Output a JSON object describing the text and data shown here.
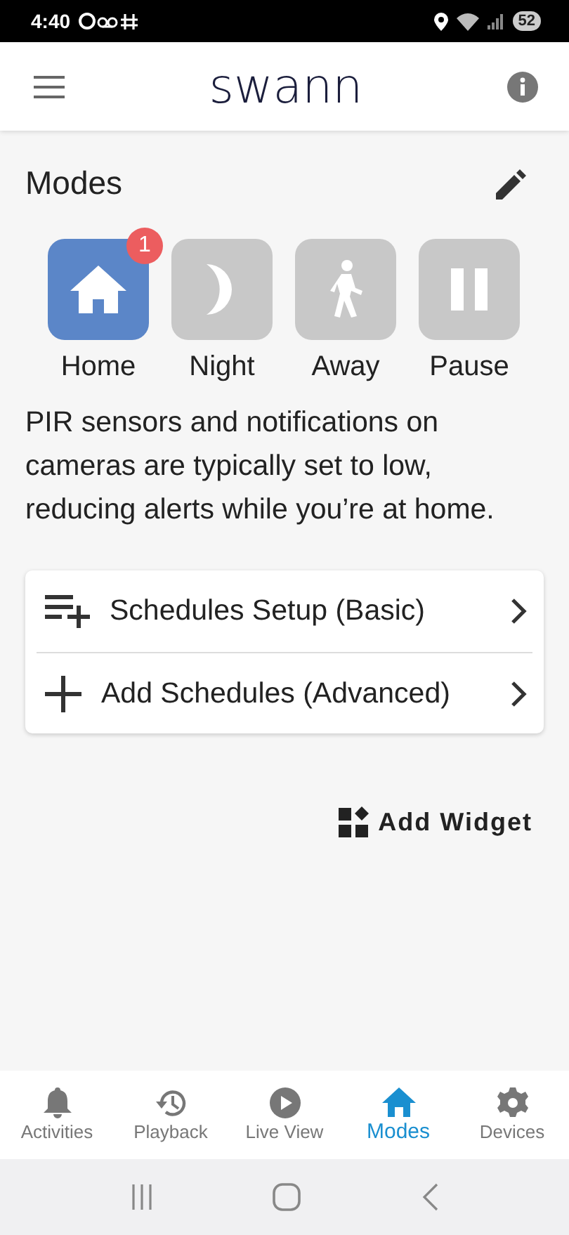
{
  "status_bar": {
    "time": "4:40",
    "battery": "52"
  },
  "header": {
    "logo": "swann"
  },
  "modes_section": {
    "title": "Modes",
    "modes": [
      {
        "kind": "home",
        "label": "Home",
        "selected": true,
        "badge": "1"
      },
      {
        "kind": "night",
        "label": "Night",
        "selected": false
      },
      {
        "kind": "away",
        "label": "Away",
        "selected": false
      },
      {
        "kind": "pause",
        "label": "Pause",
        "selected": false
      }
    ],
    "description": "PIR sensors and notifications on cameras are typically set to low, reducing alerts while you’re at home."
  },
  "schedules": [
    {
      "kind": "basic",
      "label": "Schedules Setup (Basic)"
    },
    {
      "kind": "advanced",
      "label": "Add Schedules (Advanced)"
    }
  ],
  "add_widget": "Add Widget",
  "bottom_nav": [
    {
      "kind": "activities",
      "label": "Activities",
      "selected": false
    },
    {
      "kind": "playback",
      "label": "Playback",
      "selected": false
    },
    {
      "kind": "live",
      "label": "Live View",
      "selected": false
    },
    {
      "kind": "modes",
      "label": "Modes",
      "selected": true
    },
    {
      "kind": "devices",
      "label": "Devices",
      "selected": false
    }
  ]
}
